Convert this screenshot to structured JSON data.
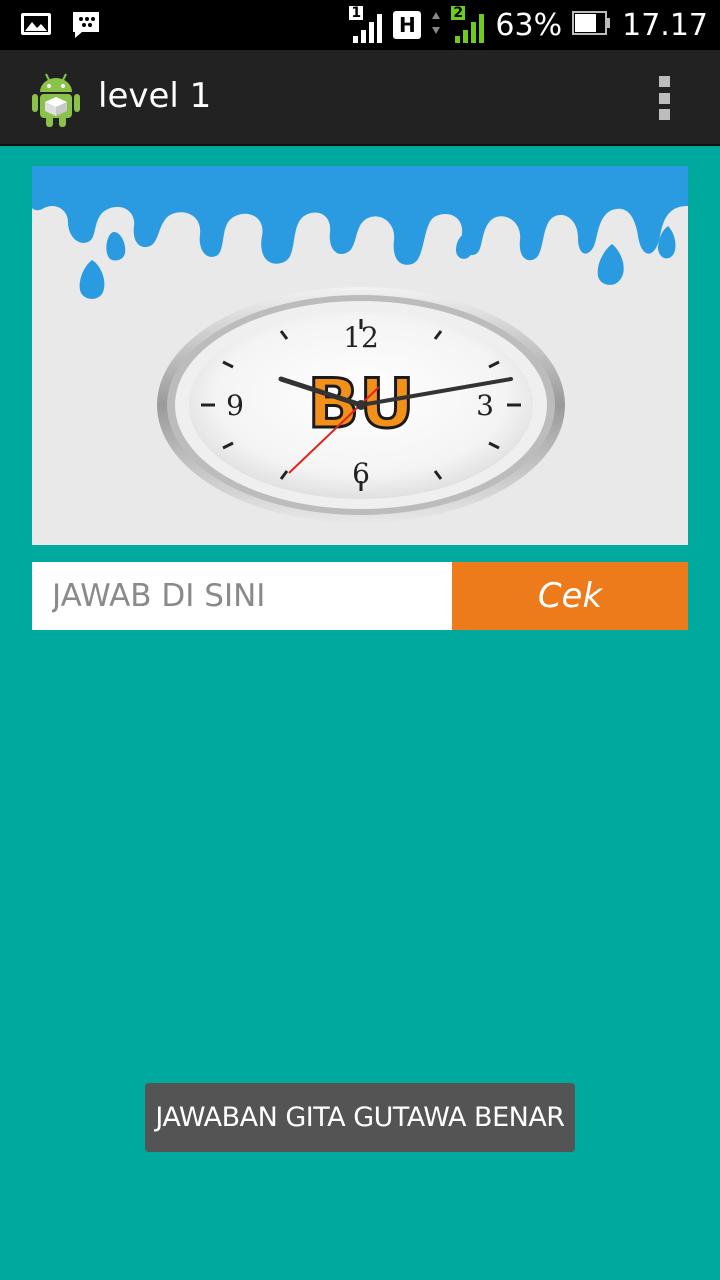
{
  "status_bar": {
    "sim1_label": "1",
    "network_type": "H",
    "sim2_label": "2",
    "battery_percent": "63%",
    "time": "17.17",
    "icons": [
      "gallery-icon",
      "bbm-icon",
      "signal-icon",
      "battery-icon"
    ]
  },
  "action_bar": {
    "title": "level 1",
    "app_icon": "android-app-icon",
    "overflow_icon": "overflow-menu-icon"
  },
  "puzzle": {
    "image_text": "BU",
    "clock_numbers": [
      "12",
      "3",
      "6",
      "9"
    ]
  },
  "answer": {
    "placeholder": "JAWAB DI SINI",
    "value": "",
    "submit_label": "Cek"
  },
  "toast": {
    "message": "JAWABAN GITA GUTAWA BENAR"
  },
  "colors": {
    "background": "#00a99e",
    "action_bar": "#222222",
    "cek_button": "#ed7b1c",
    "toast": "#545454",
    "drip_blue": "#2a9be0"
  }
}
